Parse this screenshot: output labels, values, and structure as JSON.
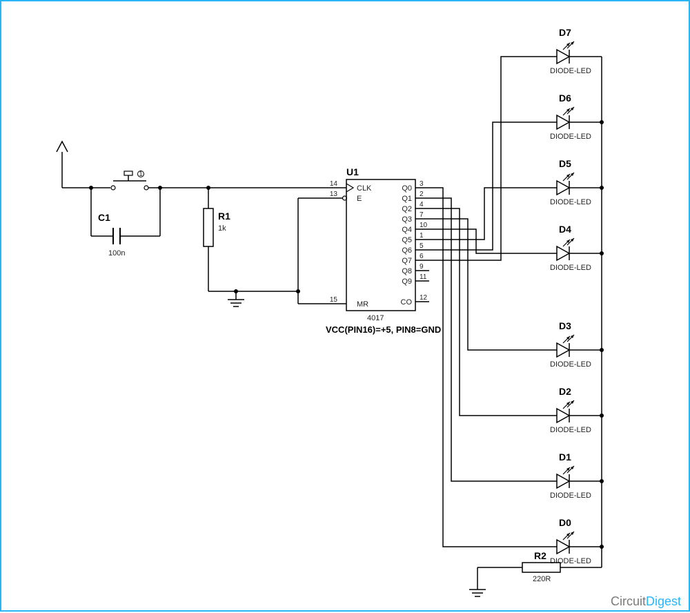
{
  "ic": {
    "ref": "U1",
    "part": "4017",
    "note": "VCC(PIN16)=+5, PIN8=GND",
    "leftPins": [
      {
        "num": "14",
        "name": "CLK"
      },
      {
        "num": "13",
        "name": "E"
      },
      {
        "num": "15",
        "name": "MR"
      }
    ],
    "rightPins": [
      {
        "num": "3",
        "name": "Q0"
      },
      {
        "num": "2",
        "name": "Q1"
      },
      {
        "num": "4",
        "name": "Q2"
      },
      {
        "num": "7",
        "name": "Q3"
      },
      {
        "num": "10",
        "name": "Q4"
      },
      {
        "num": "1",
        "name": "Q5"
      },
      {
        "num": "5",
        "name": "Q6"
      },
      {
        "num": "6",
        "name": "Q7"
      },
      {
        "num": "9",
        "name": "Q8"
      },
      {
        "num": "11",
        "name": "Q9"
      },
      {
        "num": "12",
        "name": "CO"
      }
    ]
  },
  "leds": [
    {
      "ref": "D7",
      "type": "DIODE-LED"
    },
    {
      "ref": "D6",
      "type": "DIODE-LED"
    },
    {
      "ref": "D5",
      "type": "DIODE-LED"
    },
    {
      "ref": "D4",
      "type": "DIODE-LED"
    },
    {
      "ref": "D3",
      "type": "DIODE-LED"
    },
    {
      "ref": "D2",
      "type": "DIODE-LED"
    },
    {
      "ref": "D1",
      "type": "DIODE-LED"
    },
    {
      "ref": "D0",
      "type": "DIODE-LED"
    }
  ],
  "R1": {
    "ref": "R1",
    "value": "1k"
  },
  "R2": {
    "ref": "R2",
    "value": "220R"
  },
  "C1": {
    "ref": "C1",
    "value": "100n"
  },
  "brand1": "Circuit",
  "brand2": "Digest"
}
